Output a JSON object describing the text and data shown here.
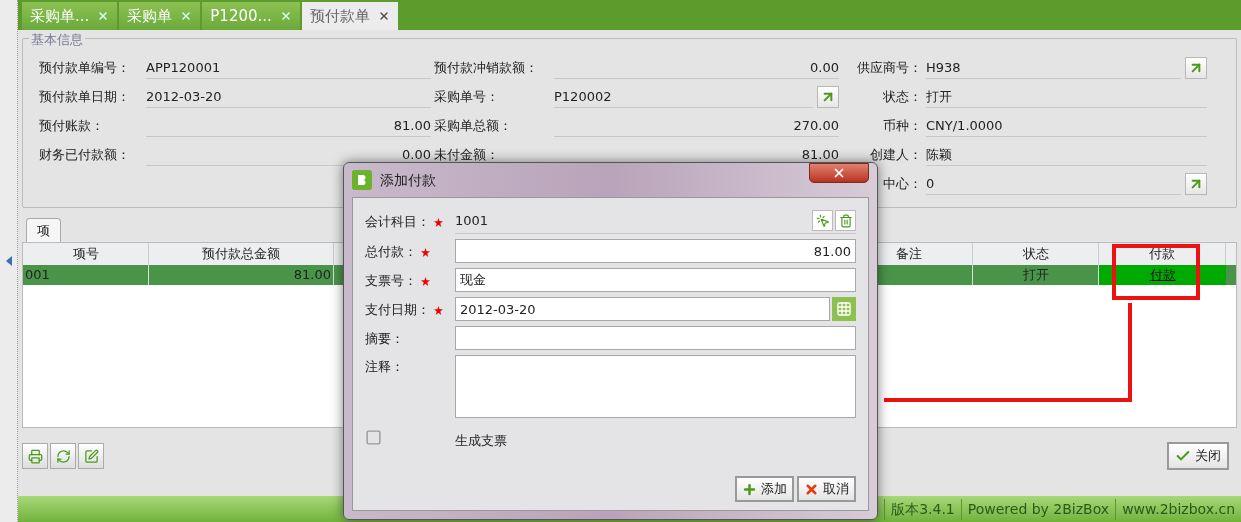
{
  "tabs": [
    {
      "label": "采购单...",
      "selected": false
    },
    {
      "label": "采购单",
      "selected": false
    },
    {
      "label": "P1200...",
      "selected": false
    },
    {
      "label": "预付款单",
      "selected": true
    }
  ],
  "basic_info": {
    "title": "基本信息",
    "columns": [
      [
        {
          "label": "预付款单编号：",
          "value": "APP120001",
          "kind": "text",
          "link": false
        },
        {
          "label": "预付款单日期：",
          "value": "2012-03-20",
          "kind": "text",
          "link": false
        },
        {
          "label": "预付账款：",
          "value": "81.00",
          "kind": "amount",
          "link": false
        },
        {
          "label": "财务已付款额：",
          "value": "0.00",
          "kind": "amount",
          "link": false
        }
      ],
      [
        {
          "label": "预付款冲销款额：",
          "value": "0.00",
          "kind": "amount",
          "link": false
        },
        {
          "label": "采购单号：",
          "value": "P120002",
          "kind": "text",
          "link": true
        },
        {
          "label": "采购单总额：",
          "value": "270.00",
          "kind": "amount",
          "link": false
        },
        {
          "label": "未付金额：",
          "value": "81.00",
          "kind": "amount",
          "link": false
        }
      ],
      [
        {
          "label": "供应商号：",
          "value": "H938",
          "kind": "text",
          "link": true
        },
        {
          "label": "状态：",
          "value": "打开",
          "kind": "text",
          "link": false
        },
        {
          "label": "币种：",
          "value": "CNY/1.0000",
          "kind": "text",
          "link": false
        },
        {
          "label": "创建人：",
          "value": "陈颖",
          "kind": "text",
          "link": false
        },
        {
          "label": "中心：",
          "value": "0",
          "kind": "text",
          "link": true
        }
      ]
    ]
  },
  "items_tab": {
    "label": "项",
    "selected": true
  },
  "table": {
    "columns": [
      "项号",
      "预付款总金额",
      "备注",
      "状态",
      "付款"
    ],
    "rows": [
      {
        "selected": true,
        "cells": [
          "001",
          "81.00",
          "",
          "打开",
          "付款"
        ]
      }
    ]
  },
  "close_button": "关闭",
  "dialog": {
    "title": "添加付款",
    "fields": [
      {
        "label": "会计科目：",
        "required": true,
        "kind": "display",
        "value": "1001"
      },
      {
        "label": "总付款：",
        "required": true,
        "kind": "amount",
        "value": "81.00"
      },
      {
        "label": "支票号：",
        "required": true,
        "kind": "input",
        "value": "现金"
      },
      {
        "label": "支付日期：",
        "required": true,
        "kind": "date",
        "value": "2012-03-20"
      },
      {
        "label": "摘要：",
        "required": false,
        "kind": "input"
      },
      {
        "label": "注释：",
        "required": false,
        "kind": "textarea"
      }
    ],
    "checkbox": {
      "label": "生成支票",
      "checked": false
    },
    "buttons": [
      {
        "label": "添加",
        "kind": "add"
      },
      {
        "label": "取消",
        "kind": "cancel"
      }
    ]
  },
  "status_bar": [
    "版本3.4.1",
    "Powered by 2BizBox",
    "www.2bizbox.cn"
  ]
}
